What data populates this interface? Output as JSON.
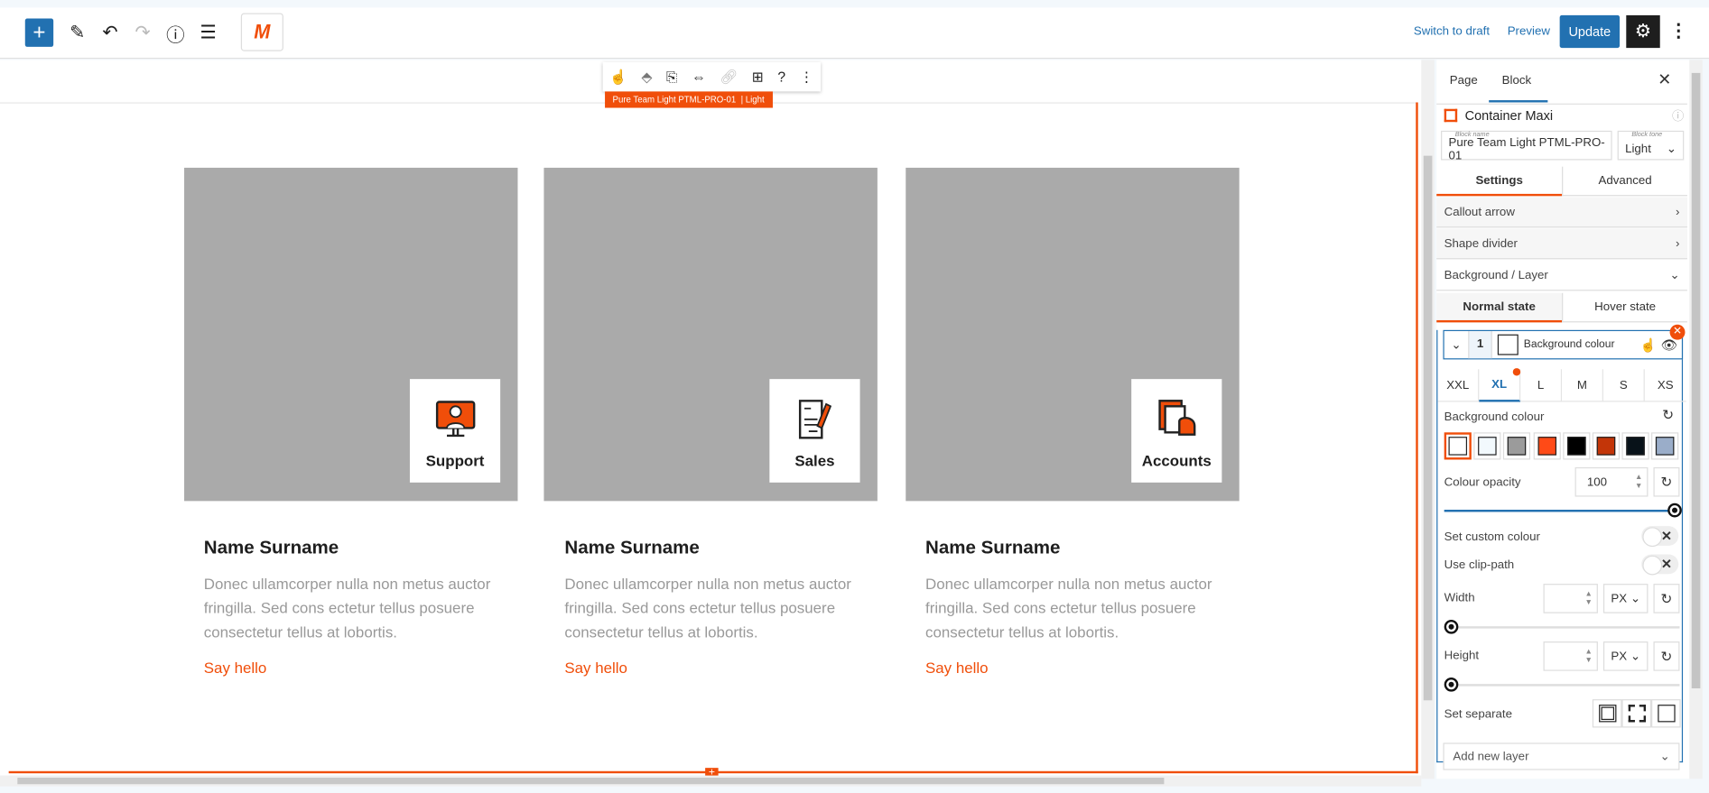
{
  "topbar": {
    "switch_to_draft": "Switch to draft",
    "preview": "Preview",
    "update": "Update",
    "add_icon": "plus-icon",
    "settings_icon": "gear-icon"
  },
  "block_toolbar": {
    "label": "Pure Team Light PTML-PRO-01  | Light"
  },
  "cards": [
    {
      "badge": "Support",
      "name": "Name Surname",
      "desc": "Donec ullamcorper nulla non metus auctor fringilla. Sed cons ectetur tellus posuere consectetur tellus at lobortis.",
      "link": "Say hello"
    },
    {
      "badge": "Sales",
      "name": "Name Surname",
      "desc": "Donec ullamcorper nulla non metus auctor fringilla. Sed cons ectetur tellus posuere consectetur tellus at lobortis.",
      "link": "Say hello"
    },
    {
      "badge": "Accounts",
      "name": "Name Surname",
      "desc": "Donec ullamcorper nulla non metus auctor fringilla. Sed cons ectetur tellus posuere consectetur tellus at lobortis.",
      "link": "Say hello"
    }
  ],
  "sidebar": {
    "tabs": [
      "Page",
      "Block"
    ],
    "block_title": "Container Maxi",
    "block_name_label": "Block name",
    "block_name": "Pure Team Light PTML-PRO-01",
    "block_tone_label": "Block tone",
    "block_tone": "Light",
    "main_tabs": [
      "Settings",
      "Advanced"
    ],
    "sections": [
      "Callout arrow",
      "Shape divider",
      "Background / Layer"
    ],
    "state_tabs": [
      "Normal state",
      "Hover state"
    ],
    "layer": {
      "number": "1",
      "name": "Background colour"
    },
    "breakpoints": [
      "XXL",
      "XL",
      "L",
      "M",
      "S",
      "XS"
    ],
    "active_breakpoint": "XL",
    "background_colour_label": "Background colour",
    "swatches": [
      "#ffffff",
      "#f2f9fd",
      "#9b9b9b",
      "#ff4a17",
      "#000000",
      "#c33508",
      "#081219",
      "#9aadc9"
    ],
    "colour_opacity_label": "Colour opacity",
    "colour_opacity": "100",
    "set_custom_colour": "Set custom colour",
    "use_clip_path": "Use clip-path",
    "width_label": "Width",
    "width_unit": "PX",
    "height_label": "Height",
    "height_unit": "PX",
    "set_separate": "Set separate",
    "add_new_layer": "Add new layer"
  },
  "colors": {
    "accent": "#ff4a17",
    "primary": "#2271b1"
  }
}
